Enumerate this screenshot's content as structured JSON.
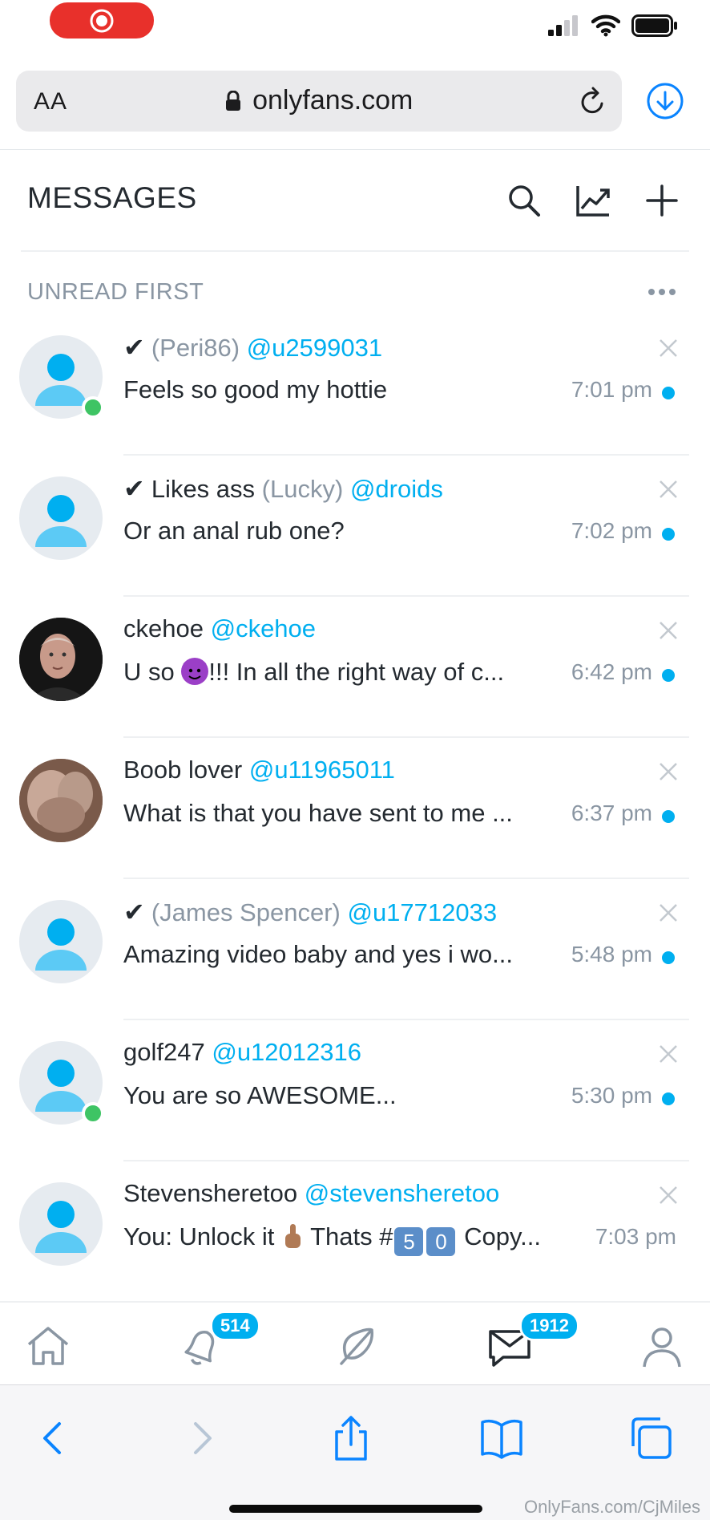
{
  "status_bar": {
    "recording": true
  },
  "browser": {
    "text_size_label": "AA",
    "url": "onlyfans.com"
  },
  "header": {
    "title": "MESSAGES",
    "filter_label": "UNREAD FIRST"
  },
  "messages": [
    {
      "verified": "✔",
      "display_name": "",
      "alias": "(Peri86)",
      "username": "@u2599031",
      "preview": "Feels so good my hottie",
      "time": "7:01 pm",
      "unread": true,
      "online": true,
      "avatar": "default"
    },
    {
      "verified": "✔",
      "display_name": "Likes ass",
      "alias": "(Lucky)",
      "username": "@droids",
      "preview": "Or an anal rub one?",
      "time": "7:02 pm",
      "unread": true,
      "online": false,
      "avatar": "default"
    },
    {
      "verified": "",
      "display_name": "ckehoe",
      "alias": "",
      "username": "@ckehoe",
      "preview_pre": "U so ",
      "preview_post": "!!! In all the right way of c...",
      "time": "6:42 pm",
      "unread": true,
      "online": false,
      "avatar": "photo"
    },
    {
      "verified": "",
      "display_name": "Boob lover",
      "alias": "",
      "username": "@u11965011",
      "preview": "What is that you have sent to me ...",
      "time": "6:37 pm",
      "unread": true,
      "online": false,
      "avatar": "photo2"
    },
    {
      "verified": "✔",
      "display_name": "",
      "alias": "(James Spencer)",
      "username": "@u17712033",
      "preview": "Amazing video baby and yes i wo...",
      "time": "5:48 pm",
      "unread": true,
      "online": false,
      "avatar": "default"
    },
    {
      "verified": "",
      "display_name": "golf247",
      "alias": "",
      "username": "@u12012316",
      "preview": "You are so AWESOME...",
      "time": "5:30 pm",
      "unread": true,
      "online": true,
      "avatar": "default"
    },
    {
      "verified": "",
      "display_name": "Stevensheretoo",
      "alias": "",
      "username": "@stevensheretoo",
      "preview_pre": "You: Unlock it ",
      "preview_mid": " Thats #",
      "keycap_1": "5",
      "keycap_2": "0",
      "preview_post": " Copy...",
      "time": "7:03 pm",
      "unread": false,
      "online": false,
      "avatar": "default"
    }
  ],
  "nav": {
    "notifications_badge": "514",
    "messages_badge": "1912"
  },
  "watermark": "OnlyFans.com/CjMiles",
  "colors": {
    "accent": "#00aff0",
    "online": "#3ec464",
    "record": "#e8302b"
  }
}
